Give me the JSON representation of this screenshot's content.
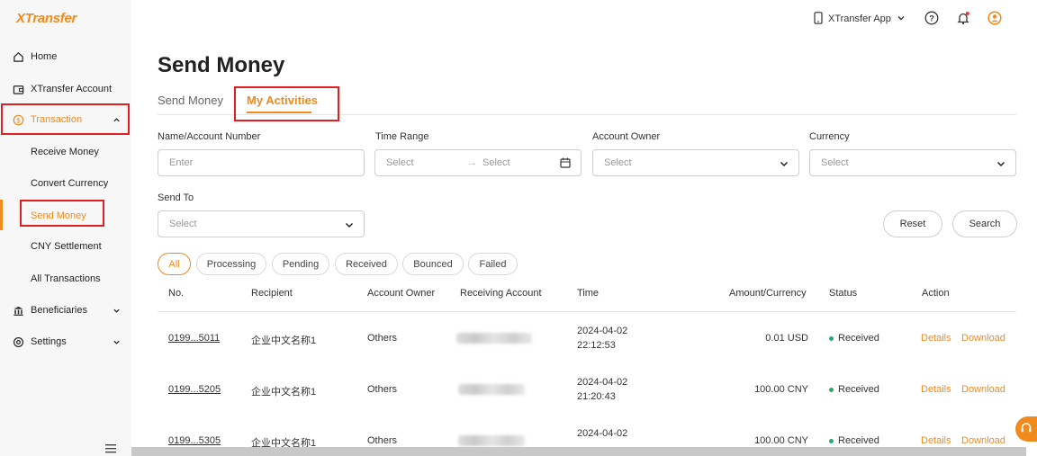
{
  "brand": {
    "logo": "XTransfer",
    "accent": "#f08a1c"
  },
  "topbar": {
    "app_label": "XTransfer App"
  },
  "sidebar": {
    "items": [
      {
        "label": "Home",
        "icon": "home-icon"
      },
      {
        "label": "XTransfer Account",
        "icon": "wallet-icon"
      },
      {
        "label": "Transaction",
        "icon": "dollar-circle-icon"
      },
      {
        "label": "Receive Money"
      },
      {
        "label": "Convert Currency"
      },
      {
        "label": "Send Money"
      },
      {
        "label": "CNY Settlement"
      },
      {
        "label": "All Transactions"
      },
      {
        "label": "Beneficiaries",
        "icon": "bank-icon"
      },
      {
        "label": "Settings",
        "icon": "gear-icon"
      }
    ]
  },
  "page": {
    "title": "Send Money"
  },
  "tabs": [
    {
      "label": "Send Money"
    },
    {
      "label": "My Activities"
    }
  ],
  "filters": {
    "name_label": "Name/Account Number",
    "name_placeholder": "Enter",
    "time_label": "Time Range",
    "time_start": "Select",
    "time_arrow": "→",
    "time_end": "Select",
    "owner_label": "Account Owner",
    "owner_value": "Select",
    "currency_label": "Currency",
    "currency_value": "Select",
    "sendto_label": "Send To",
    "sendto_value": "Select",
    "reset": "Reset",
    "search": "Search"
  },
  "status_chips": [
    "All",
    "Processing",
    "Pending",
    "Received",
    "Bounced",
    "Failed"
  ],
  "table": {
    "headers": [
      "No.",
      "Recipient",
      "Account Owner",
      "Receiving Account",
      "Time",
      "Amount/Currency",
      "Status",
      "Action"
    ],
    "rows": [
      {
        "no": "0199...5011",
        "recipient": "企业中文名称1",
        "owner": "Others",
        "date": "2024-04-02",
        "time": "22:12:53",
        "amount": "0.01 USD",
        "status": "Received",
        "details": "Details",
        "download": "Download"
      },
      {
        "no": "0199...5205",
        "recipient": "企业中文名称1",
        "owner": "Others",
        "date": "2024-04-02",
        "time": "21:20:43",
        "amount": "100.00 CNY",
        "status": "Received",
        "details": "Details",
        "download": "Download"
      },
      {
        "no": "0199...5305",
        "recipient": "企业中文名称1",
        "owner": "Others",
        "date": "2024-04-02",
        "time": "",
        "amount": "100.00 CNY",
        "status": "Received",
        "details": "Details",
        "download": "Download"
      }
    ]
  }
}
